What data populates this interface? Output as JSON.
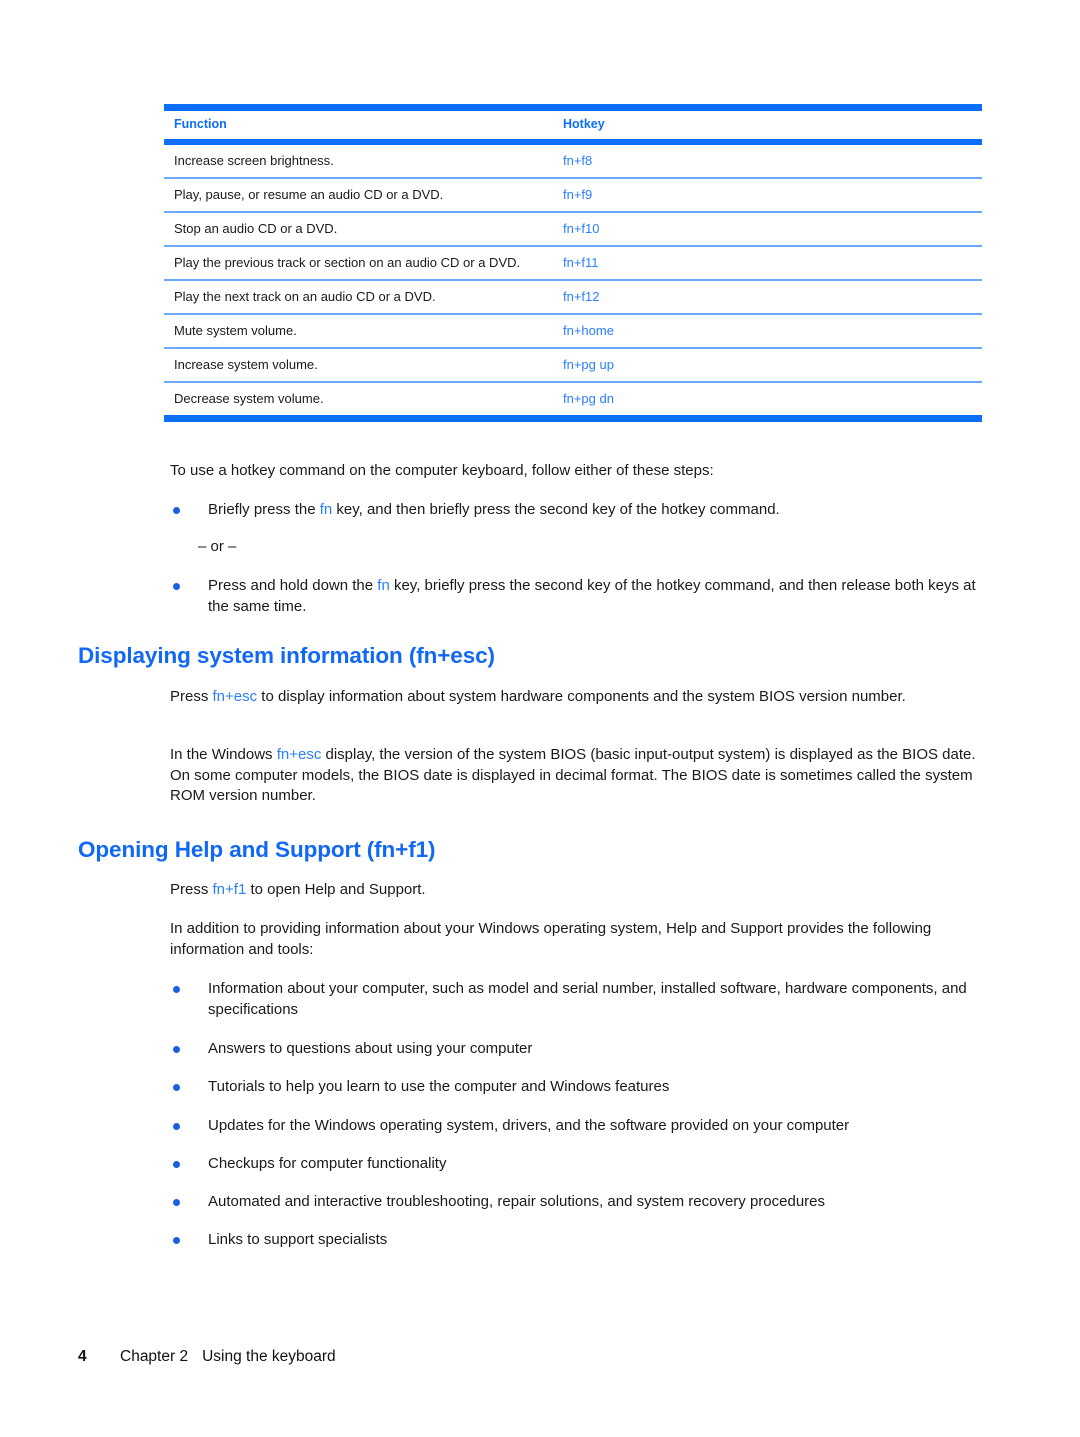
{
  "table": {
    "columns": [
      "Function",
      "Hotkey"
    ],
    "rows": [
      {
        "function": "Increase screen brightness.",
        "hotkey": "fn+f8"
      },
      {
        "function": "Play, pause, or resume an audio CD or a DVD.",
        "hotkey": "fn+f9"
      },
      {
        "function": "Stop an audio CD or a DVD.",
        "hotkey": "fn+f10"
      },
      {
        "function": "Play the previous track or section on an audio CD or a DVD.",
        "hotkey": "fn+f11"
      },
      {
        "function": "Play the next track on an audio CD or a DVD.",
        "hotkey": "fn+f12"
      },
      {
        "function": "Mute system volume.",
        "hotkey": "fn+home"
      },
      {
        "function": "Increase system volume.",
        "hotkey": "fn+pg up"
      },
      {
        "function": "Decrease system volume.",
        "hotkey": "fn+pg dn"
      }
    ]
  },
  "intro": {
    "lead": "To use a hotkey command on the computer keyboard, follow either of these steps:",
    "step1_before": "Briefly press the ",
    "step1_key": "fn",
    "step1_after": " key, and then briefly press the second key of the hotkey command.",
    "or_label": "– or –",
    "step2_before": "Press and hold down the ",
    "step2_key": "fn",
    "step2_after": " key, briefly press the second key of the hotkey command, and then release both keys at the same time."
  },
  "section_sysinfo": {
    "heading": "Displaying system information (fn+esc)",
    "p1_before": "Press ",
    "p1_key": "fn+esc",
    "p1_after": " to display information about system hardware components and the system BIOS version number.",
    "p2_before": "In the Windows ",
    "p2_key": "fn+esc",
    "p2_after": " display, the version of the system BIOS (basic input-output system) is displayed as the BIOS date. On some computer models, the BIOS date is displayed in decimal format. The BIOS date is sometimes called the system ROM version number."
  },
  "section_help": {
    "heading": "Opening Help and Support (fn+f1)",
    "p1_before": "Press ",
    "p1_key": "fn+f1",
    "p1_after": " to open Help and Support.",
    "p2": "In addition to providing information about your Windows operating system, Help and Support provides the following information and tools:",
    "bullets": [
      "Information about your computer, such as model and serial number, installed software, hardware components, and specifications",
      "Answers to questions about using your computer",
      "Tutorials to help you learn to use the computer and Windows features",
      "Updates for the Windows operating system, drivers, and the software provided on your computer",
      "Checkups for computer functionality",
      "Automated and interactive troubleshooting, repair solutions, and system recovery procedures",
      "Links to support specialists"
    ]
  },
  "footer": {
    "page_number": "4",
    "chapter": "Chapter 2",
    "title": "Using the keyboard"
  },
  "colors": {
    "accent_blue": "#0b6ffa",
    "heading_blue": "#1168f5",
    "key_blue": "#2a7fff",
    "rule_light": "#6ba9fb"
  }
}
